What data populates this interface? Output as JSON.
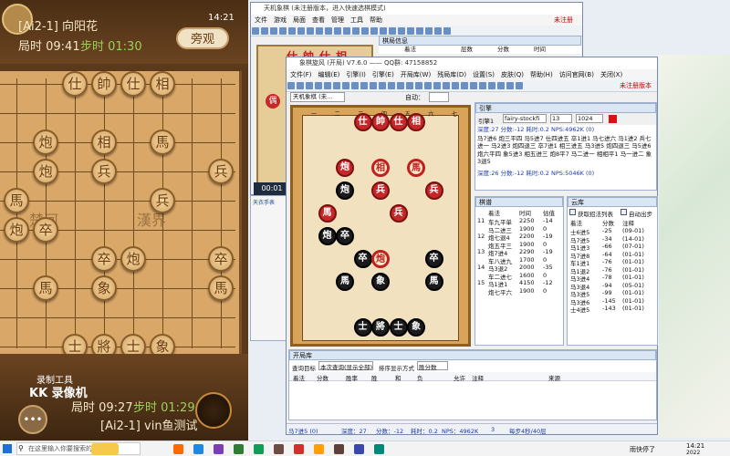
{
  "game": {
    "top_player": {
      "name": "[Ai2-1] 向阳花",
      "time": "局时 09:41",
      "step": "步时 01:30"
    },
    "watch_button": "旁观",
    "clock": "14:21",
    "pieces": [
      {
        "t": "仕",
        "c": "blk"
      },
      {
        "t": "帥",
        "c": "blk"
      },
      {
        "t": "仕",
        "c": "blk"
      },
      {
        "t": "相",
        "c": "blk"
      },
      {
        "t": "炮",
        "c": "blk"
      },
      {
        "t": "相",
        "c": "blk"
      },
      {
        "t": "馬",
        "c": "blk"
      },
      {
        "t": "炮",
        "c": "blk"
      },
      {
        "t": "兵",
        "c": "blk"
      },
      {
        "t": "兵",
        "c": "blk"
      },
      {
        "t": "馬",
        "c": "blk"
      },
      {
        "t": "兵",
        "c": "blk"
      },
      {
        "t": "炮",
        "c": "blk"
      },
      {
        "t": "卒",
        "c": "blk"
      },
      {
        "t": "卒",
        "c": "blk"
      },
      {
        "t": "炮",
        "c": "blk"
      },
      {
        "t": "卒",
        "c": "blk"
      },
      {
        "t": "馬",
        "c": "blk"
      },
      {
        "t": "象",
        "c": "blk"
      },
      {
        "t": "馬",
        "c": "blk"
      },
      {
        "t": "士",
        "c": "blk"
      },
      {
        "t": "將",
        "c": "blk"
      },
      {
        "t": "士",
        "c": "blk"
      },
      {
        "t": "象",
        "c": "blk"
      }
    ],
    "river_left": "楚河",
    "river_right": "漢界",
    "recorder_tool": "录制工具",
    "recorder_name": "KK 录像机",
    "bottom_player": {
      "name": "[Ai2-1] vin鱼测试",
      "time": "局时 09:27",
      "step": "步时 01:29"
    }
  },
  "back_window": {
    "title": "天机象棋 (未注册版本，进入快速选棋模式)",
    "menu": [
      "文件",
      "游戏",
      "局面",
      "查看",
      "管理",
      "工具",
      "帮助"
    ],
    "status": "未注册",
    "panel_title": "棋局信息",
    "cols": [
      "着法",
      "层数",
      "分数",
      "时间"
    ],
    "piece_labels": [
      "仕",
      "帥",
      "仕",
      "相"
    ],
    "mini_piece": "偶"
  },
  "main_window": {
    "title": "象棋旋风 (开局) V7.6.0 —— QQ群: 47158852",
    "menu": [
      "文件(F)",
      "编辑(E)",
      "引擎(I)",
      "引擎(E)",
      "开局库(W)",
      "残局库(D)",
      "设置(S)",
      "皮肤(Q)",
      "帮助(H)",
      "访问官网(B)",
      "关闭(X)"
    ],
    "register": "未注册版本",
    "engine_select": "天机象棋 (未...",
    "auto_label": "自动：",
    "ruler_top": [
      "一",
      "二",
      "三",
      "四",
      "五",
      "六",
      "七"
    ],
    "pieces": [
      {
        "t": "仕",
        "s": "rf"
      },
      {
        "t": "帥",
        "s": "rf"
      },
      {
        "t": "仕",
        "s": "rf"
      },
      {
        "t": "相",
        "s": "rf"
      },
      {
        "t": "炮",
        "s": "rf"
      },
      {
        "t": "相",
        "s": "red"
      },
      {
        "t": "馬",
        "s": "red"
      },
      {
        "t": "炮",
        "s": "bf"
      },
      {
        "t": "兵",
        "s": "rf"
      },
      {
        "t": "兵",
        "s": "rf"
      },
      {
        "t": "馬",
        "s": "rf"
      },
      {
        "t": "兵",
        "s": "rf"
      },
      {
        "t": "炮",
        "s": "bf"
      },
      {
        "t": "卒",
        "s": "bf"
      },
      {
        "t": "卒",
        "s": "bf"
      },
      {
        "t": "炮",
        "s": "red"
      },
      {
        "t": "卒",
        "s": "bf"
      },
      {
        "t": "馬",
        "s": "bf"
      },
      {
        "t": "象",
        "s": "bf"
      },
      {
        "t": "馬",
        "s": "bf"
      },
      {
        "t": "士",
        "s": "bf"
      },
      {
        "t": "將",
        "s": "bf"
      },
      {
        "t": "士",
        "s": "bf"
      },
      {
        "t": "象",
        "s": "bf"
      }
    ],
    "engine_panel": {
      "title": "引擎",
      "engine_label": "引擎1",
      "engine_name": "fairy-stockfi",
      "threads": "13",
      "hash": "1024",
      "line1": "深度:27  分数:-12  耗时:0.2  NPS:4962K  (0)",
      "pv1": "马7进6 炮三平四 马5进7 仕四进五 卒1进1 马七进六 马1进2 兵七进一 马2进3 炮四退三 卒7进1 相三进五 马3进5 炮四退三 马5进6 炮六平四 象5进3 相五进三 炮8平7 马二进一 相相平1 马一进二 象3退5",
      "line2": "深度:26  分数:-12  耗时:0.2  NPS:5046K  (0)"
    },
    "book_panel": {
      "title": "棋谱",
      "cols": [
        "",
        "着法",
        "时间",
        "估值"
      ],
      "rows": [
        [
          "11",
          "车九平单",
          "2250",
          "-14"
        ],
        [
          "",
          "马二进三",
          "1900",
          "0"
        ],
        [
          "12",
          "炮七退4",
          "2200",
          "-19"
        ],
        [
          "",
          "炮五平三",
          "1900",
          "0"
        ],
        [
          "13",
          "炮7进4",
          "2290",
          "-19"
        ],
        [
          "",
          "车八进九",
          "1700",
          "0"
        ],
        [
          "14",
          "马3退2",
          "2000",
          "-35"
        ],
        [
          "",
          "车二进七",
          "1600",
          "0"
        ],
        [
          "15",
          "马1进1",
          "4150",
          "-12"
        ],
        [
          "",
          "炮七平六",
          "1900",
          "0"
        ]
      ]
    },
    "lib_panel": {
      "title": "云库",
      "check1": "获取招法列表",
      "check2": "自动出步",
      "cols": [
        "着法",
        "分数",
        "注释"
      ],
      "rows": [
        [
          "士6进5",
          "-25",
          "(09-01)"
        ],
        [
          "马7进5",
          "-34",
          "(14-01)"
        ],
        [
          "马1进3",
          "-66",
          "(07-01)"
        ],
        [
          "马7进8",
          "-64",
          "(01-01)"
        ],
        [
          "车1进1",
          "-76",
          "(01-01)"
        ],
        [
          "马1退2",
          "-76",
          "(01-01)"
        ],
        [
          "马3进4",
          "-78",
          "(01-01)"
        ],
        [
          "马3退4",
          "-94",
          "(05-01)"
        ],
        [
          "马3进5",
          "-99",
          "(01-01)"
        ],
        [
          "马3进6",
          "-145",
          "(01-01)"
        ],
        [
          "士4进5",
          "-143",
          "(01-01)"
        ]
      ]
    },
    "open_panel": {
      "title": "开局库",
      "select1_label": "查询目标",
      "select1": "本次查询(显示全部)",
      "select2_label": "排序显示方式",
      "select2": "胜分数",
      "cols": [
        "着法",
        "分数",
        "胜率",
        "胜",
        "和",
        "负",
        "允许",
        "注释",
        "来源"
      ]
    },
    "status_bar": [
      "马7进5 (0)",
      "深度：27",
      "分数：-12",
      "耗时：0.2",
      "NPS：4962K",
      "3",
      "每步4秒/40层"
    ]
  },
  "float_window": {
    "title": "天衣手表"
  },
  "back_clock": "00:01",
  "taskbar": {
    "search_placeholder": "在这里输入你要搜索的内容",
    "weather": "雨快停了",
    "clock_time": "14:21",
    "clock_date": "2022"
  }
}
